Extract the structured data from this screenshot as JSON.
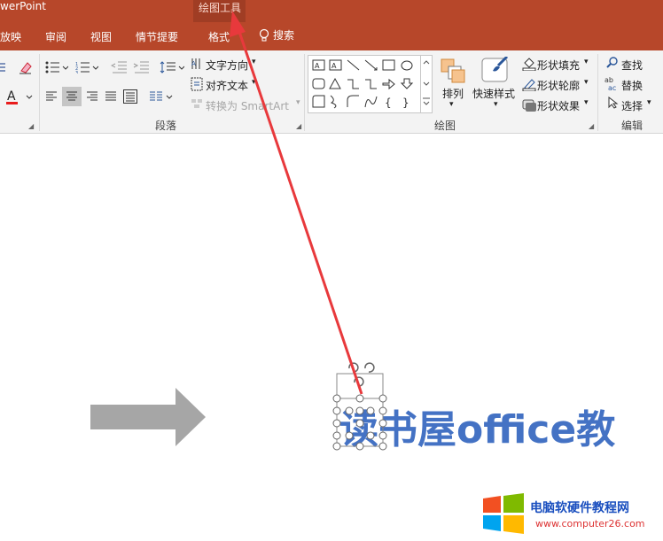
{
  "titlebar": {
    "app_title": "werPoint",
    "context_title": "绘图工具"
  },
  "tabs": [
    "放映",
    "审阅",
    "视图",
    "情节提要",
    "格式"
  ],
  "active_tab": "格式",
  "tell_me": "搜索",
  "ribbon": {
    "paragraph": {
      "label": "段落",
      "text_direction": "文字方向",
      "align_text": "对齐文本",
      "convert_smartart": "转换为 SmartArt"
    },
    "drawing": {
      "label": "绘图",
      "arrange": "排列",
      "quick_styles": "快速样式",
      "shape_fill": "形状填充",
      "shape_outline": "形状轮廓",
      "shape_effects": "形状效果"
    },
    "editing": {
      "label": "编辑",
      "find": "查找",
      "replace": "替换",
      "select": "选择"
    }
  },
  "slide": {
    "text": "读书屋office教",
    "text_color": "#4472c4"
  },
  "watermark": {
    "site_name": "电脑软硬件教程网",
    "url": "www.computer26.com"
  },
  "colors": {
    "ribbon_red": "#b7472a",
    "annotation_arrow": "#e8393c",
    "font_color_red": "#e81c1c"
  }
}
